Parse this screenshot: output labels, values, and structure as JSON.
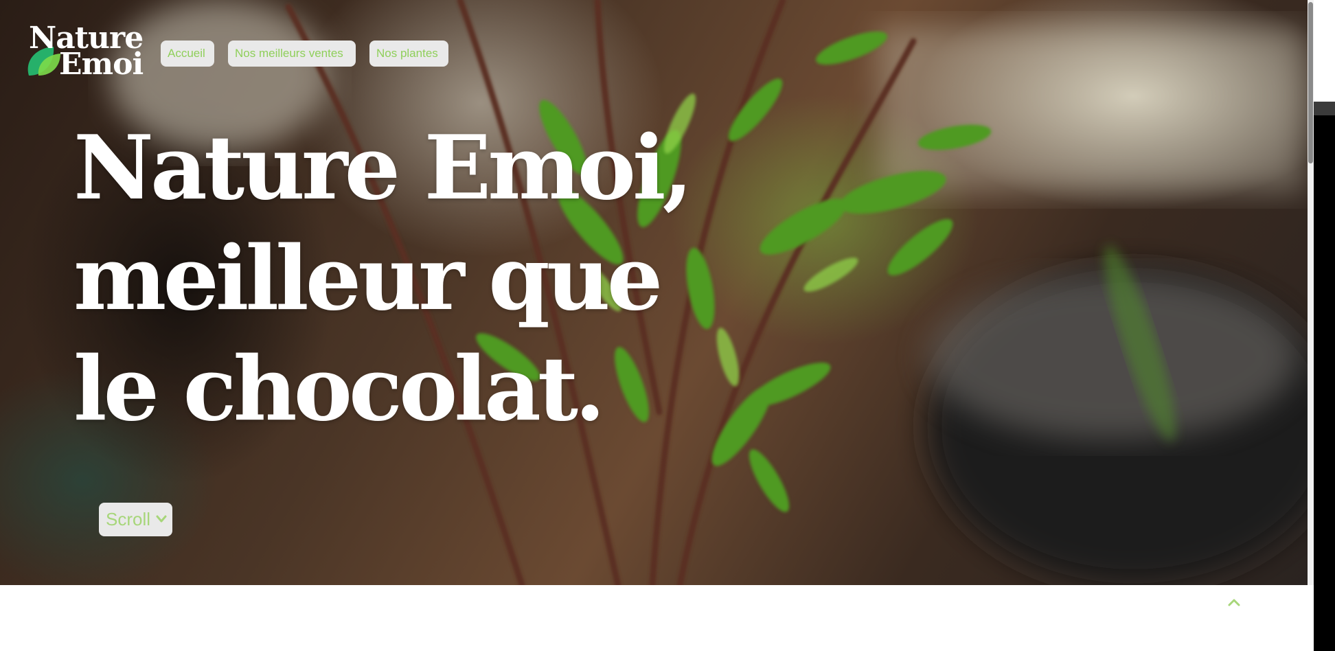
{
  "header": {
    "logo": {
      "line1": "Nature",
      "line2": "Emoi"
    },
    "nav": [
      {
        "label": "Accueil"
      },
      {
        "label": "Nos meilleurs ventes"
      },
      {
        "label": "Nos plantes"
      }
    ]
  },
  "hero": {
    "headline_lines": [
      "Nature Emoi,",
      "meilleur que",
      "le chocolat."
    ],
    "scroll_label": "Scroll",
    "scroll_icon": "chevron-down-icon"
  },
  "back_to_top_icon": "chevron-up-icon",
  "colors": {
    "accent": "#8fcf5a",
    "button_bg": "#e9e9e9",
    "headline": "#ffffff"
  }
}
